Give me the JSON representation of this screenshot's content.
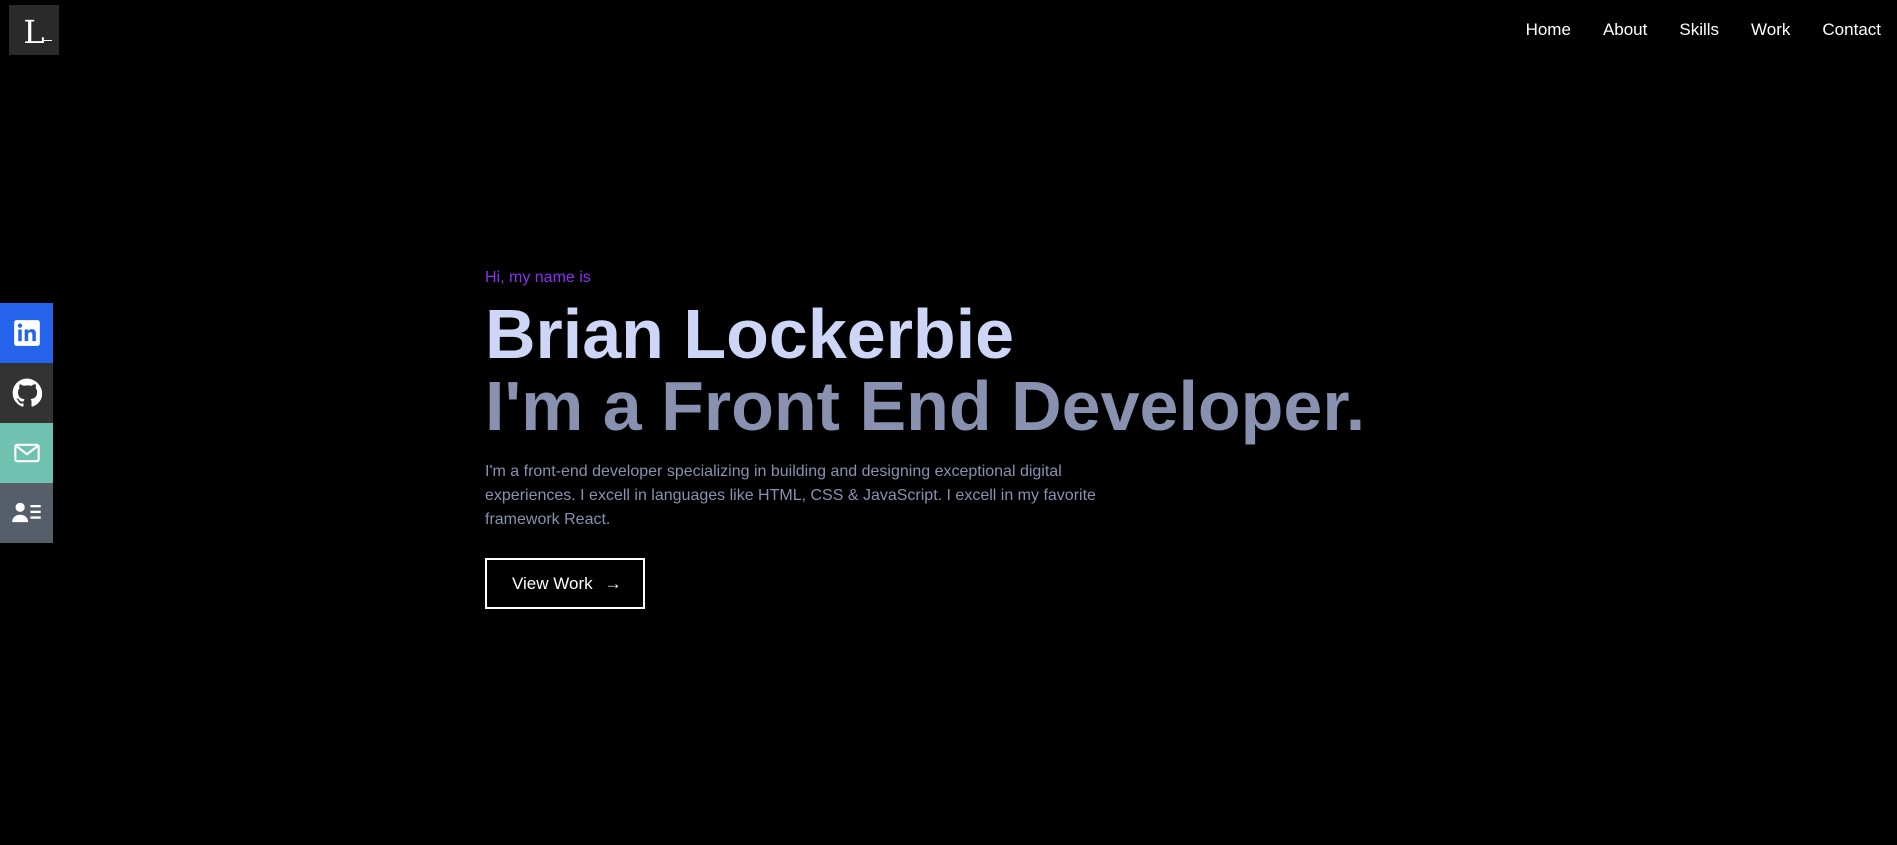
{
  "header": {
    "logo_letter": "L",
    "nav": [
      {
        "label": "Home"
      },
      {
        "label": "About"
      },
      {
        "label": "Skills"
      },
      {
        "label": "Work"
      },
      {
        "label": "Contact"
      }
    ]
  },
  "social": [
    {
      "name": "linkedin",
      "icon": "linkedin-icon",
      "color": "#2563eb"
    },
    {
      "name": "github",
      "icon": "github-icon",
      "color": "#333333"
    },
    {
      "name": "email",
      "icon": "mail-icon",
      "color": "#6fc2b0"
    },
    {
      "name": "resume",
      "icon": "user-card-icon",
      "color": "#565f69"
    }
  ],
  "hero": {
    "greeting": "Hi, my name is",
    "name": "Brian Lockerbie",
    "role": "I'm a Front End Developer.",
    "description": "I'm a front-end developer specializing in building and designing exceptional digital experiences. I excell in languages like HTML, CSS & JavaScript. I excell in my favorite framework React.",
    "button_label": "View Work",
    "button_arrow": "→"
  },
  "colors": {
    "background": "#000000",
    "accent": "#8b2ff0",
    "name": "#cdd6f6",
    "muted": "#8892b0"
  }
}
